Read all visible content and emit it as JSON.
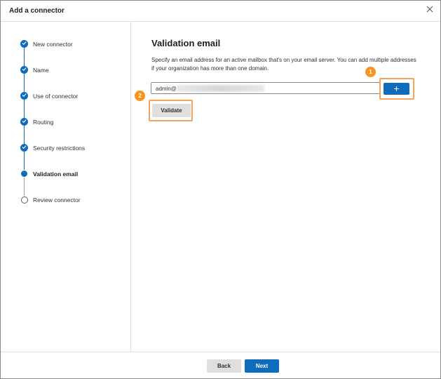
{
  "dialog": {
    "title": "Add a connector",
    "close_icon": "close-icon"
  },
  "steps": [
    {
      "label": "New connector",
      "state": "done"
    },
    {
      "label": "Name",
      "state": "done"
    },
    {
      "label": "Use of connector",
      "state": "done"
    },
    {
      "label": "Routing",
      "state": "done"
    },
    {
      "label": "Security restrictions",
      "state": "done"
    },
    {
      "label": "Validation email",
      "state": "current"
    },
    {
      "label": "Review connector",
      "state": "todo"
    }
  ],
  "main": {
    "heading": "Validation email",
    "description": "Specify an email address for an active mailbox that's on your email server. You can add multiple addresses if your organization has more than one domain.",
    "email_value": "admin@",
    "add_button_label": "+",
    "validate_label": "Validate",
    "callouts": [
      "1",
      "2"
    ]
  },
  "footer": {
    "back_label": "Back",
    "next_label": "Next"
  },
  "colors": {
    "accent": "#0f6cbd",
    "callout": "#f7941d"
  }
}
